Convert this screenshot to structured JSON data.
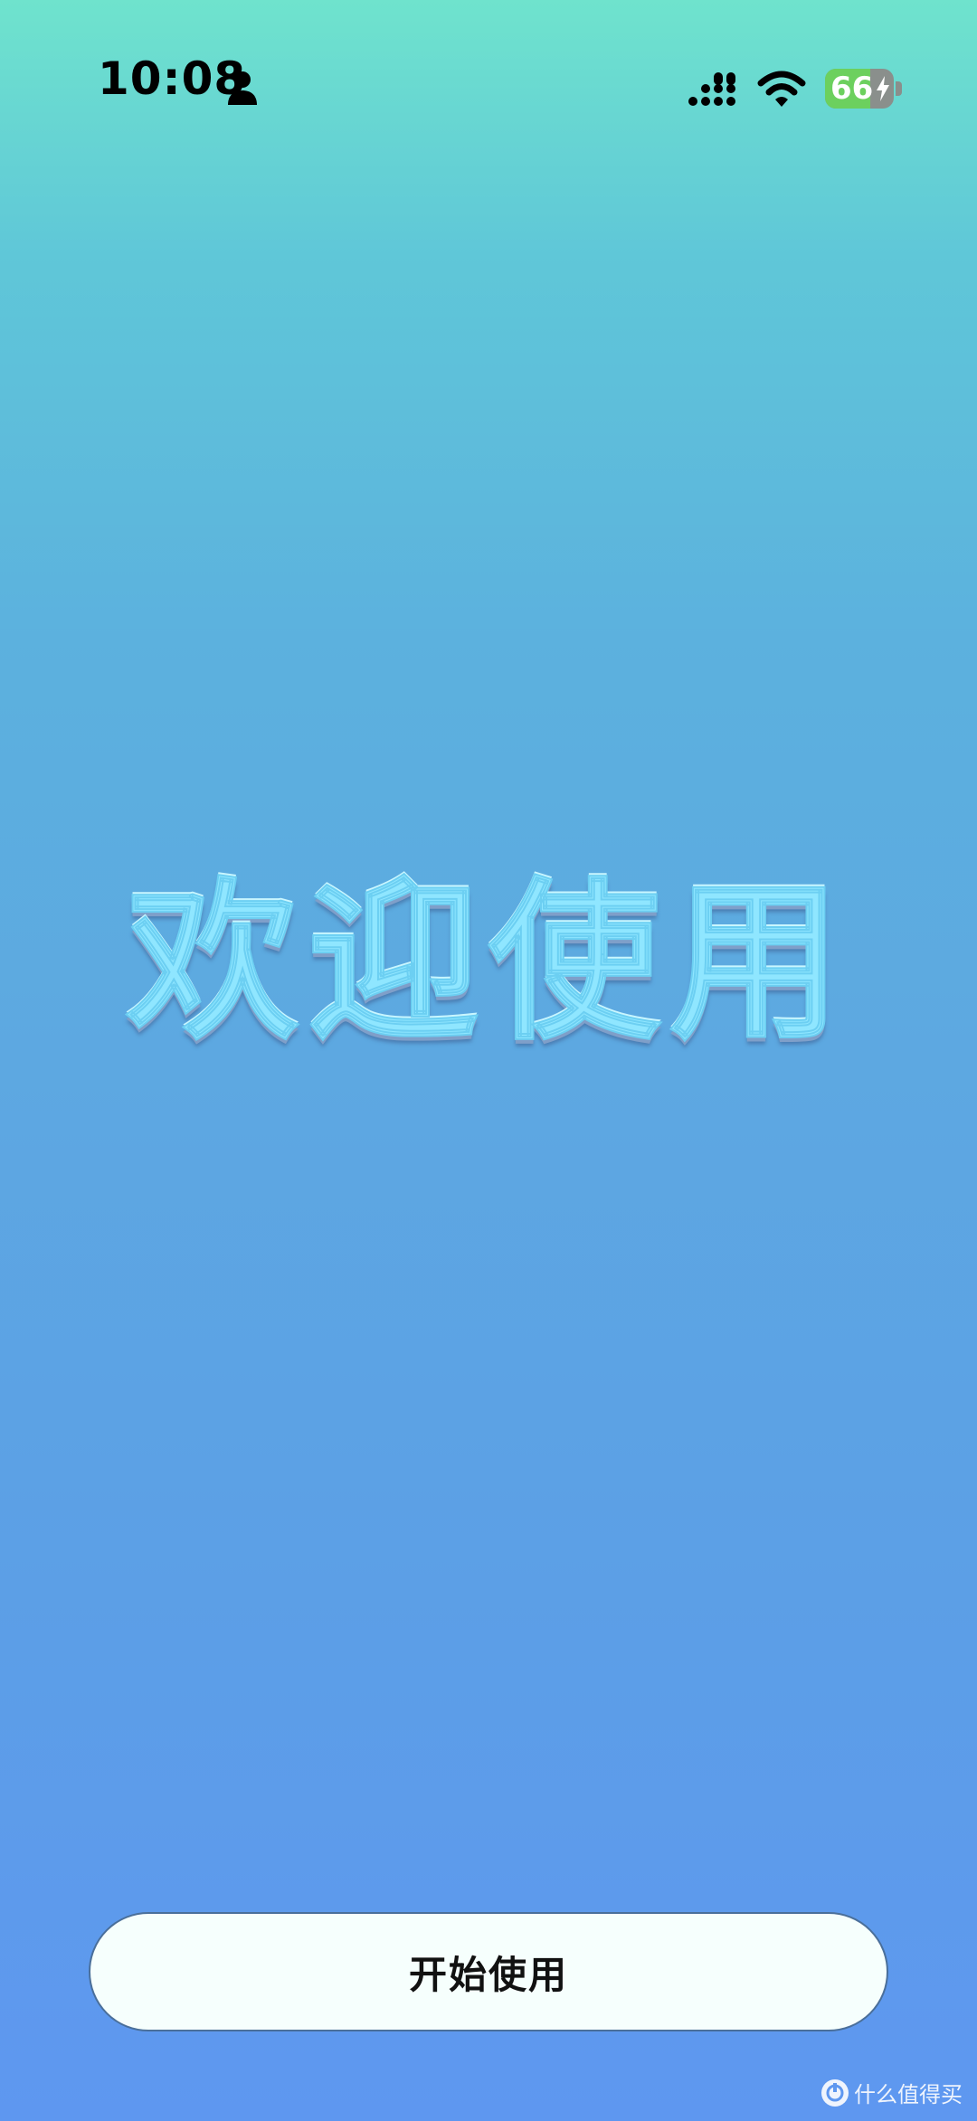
{
  "status_bar": {
    "time": "10:08",
    "battery_level": "66",
    "battery_fraction": 0.66,
    "icons": [
      "person-icon",
      "signal-icon",
      "wifi-icon",
      "battery-icon",
      "bolt-icon"
    ]
  },
  "welcome": {
    "title": "欢迎使用"
  },
  "start_button": {
    "label": "开始使用"
  },
  "watermark": {
    "text": "什么值得买",
    "icon": "watermark-logo-icon"
  },
  "colors": {
    "gradient_top": "#6fe3cd",
    "gradient_bottom": "#5e97f0",
    "title_fill": "#8fe6ff",
    "button_bg": "#f6fffd",
    "battery_green": "#6cd05e"
  }
}
